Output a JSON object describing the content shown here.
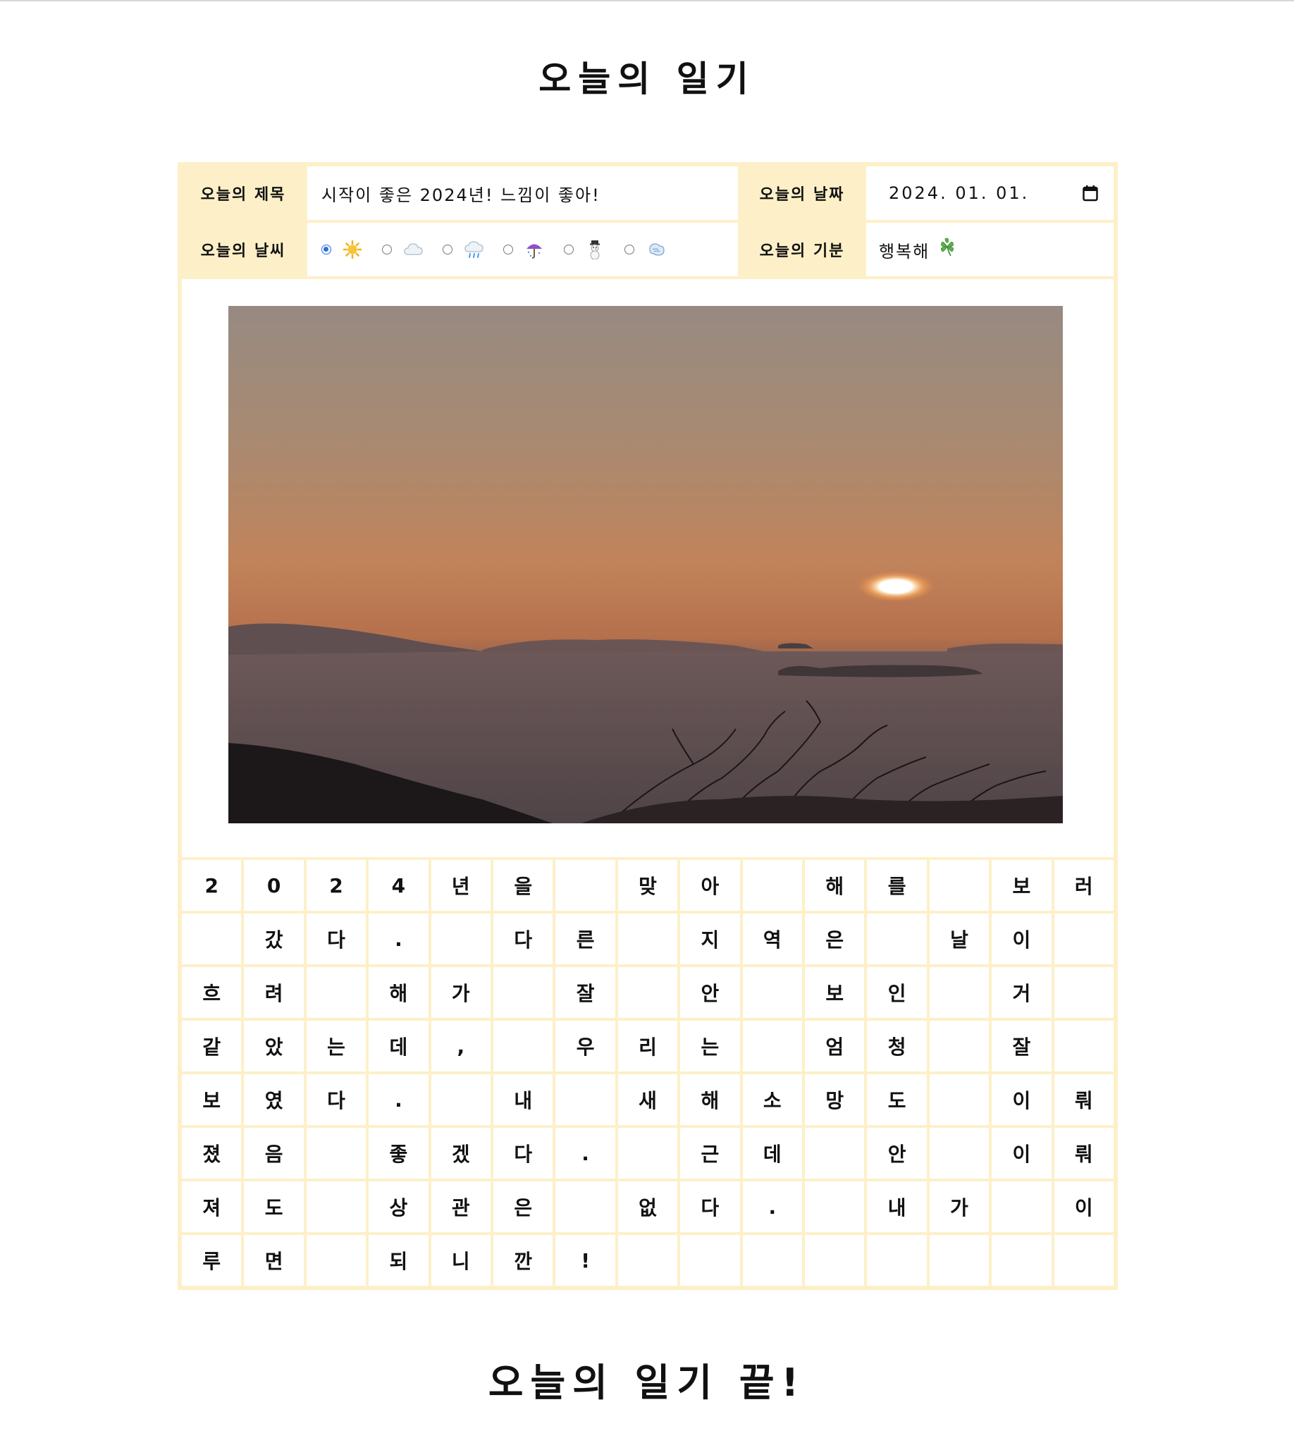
{
  "title": "오늘의 일기",
  "footer": "오늘의 일기 끝!",
  "info": {
    "title_label": "오늘의 제목",
    "title_value": "시작이 좋은 2024년! 느낌이 좋아!",
    "date_label": "오늘의 날짜",
    "date_value": "2024. 01. 01.",
    "weather_label": "오늘의 날씨",
    "weather_options": [
      {
        "icon": "sun-icon",
        "glyph": "☀️",
        "checked": true
      },
      {
        "icon": "cloud-icon",
        "glyph": "☁️",
        "checked": false
      },
      {
        "icon": "rain-cloud-icon",
        "glyph": "🌧️",
        "checked": false
      },
      {
        "icon": "umbrella-icon",
        "glyph": "☔",
        "checked": false
      },
      {
        "icon": "snowman-icon",
        "glyph": "☃️",
        "checked": false
      },
      {
        "icon": "wind-icon",
        "glyph": "💨",
        "checked": false
      }
    ],
    "mood_label": "오늘의 기분",
    "mood_value": "행복해",
    "mood_icon": "four-leaf-clover-icon"
  },
  "colors": {
    "label_bg": "#fdf0c8",
    "radio_checked": "#2b6de0"
  },
  "manuscript": [
    "2",
    "0",
    "2",
    "4",
    "년",
    "을",
    "",
    "맞",
    "아",
    "",
    "해",
    "를",
    "",
    "보",
    "러",
    "",
    "갔",
    "다",
    ".",
    "",
    "다",
    "른",
    "",
    "지",
    "역",
    "은",
    "",
    "날",
    "이",
    "",
    "흐",
    "려",
    "",
    "해",
    "가",
    "",
    "잘",
    "",
    "안",
    "",
    "보",
    "인",
    "",
    "거",
    "",
    "같",
    "았",
    "는",
    "데",
    ",",
    "",
    "우",
    "리",
    "는",
    "",
    "엄",
    "청",
    "",
    "잘",
    "",
    "보",
    "였",
    "다",
    ".",
    "",
    "내",
    "",
    "새",
    "해",
    "소",
    "망",
    "도",
    "",
    "이",
    "뤄",
    "졌",
    "음",
    "",
    "좋",
    "겠",
    "다",
    ".",
    "",
    "근",
    "데",
    "",
    "안",
    "",
    "이",
    "뤄",
    "져",
    "도",
    "",
    "상",
    "관",
    "은",
    "",
    "없",
    "다",
    ".",
    "",
    "내",
    "가",
    "",
    "이",
    "루",
    "면",
    "",
    "되",
    "니",
    "깐",
    "!",
    "",
    "",
    "",
    "",
    "",
    "",
    "",
    ""
  ]
}
